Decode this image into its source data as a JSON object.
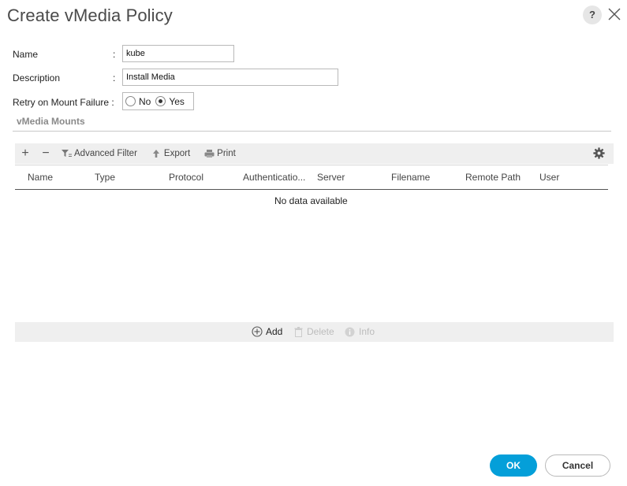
{
  "dialog": {
    "title": "Create vMedia Policy",
    "help_label": "?"
  },
  "form": {
    "name_label": "Name",
    "name_value": "kube",
    "description_label": "Description",
    "description_value": "Install Media",
    "retry_label": "Retry on Mount Failure :",
    "retry_options": [
      "No",
      "Yes"
    ],
    "retry_selected": "Yes",
    "colon": ":"
  },
  "mounts": {
    "section_title": "vMedia Mounts",
    "toolbar": {
      "add_symbol": "+",
      "remove_symbol": "−",
      "advanced_filter_label": "Advanced Filter",
      "export_label": "Export",
      "print_label": "Print"
    },
    "columns": [
      "Name",
      "Type",
      "Protocol",
      "Authenticatio...",
      "Server",
      "Filename",
      "Remote Path",
      "User"
    ],
    "empty_message": "No data available",
    "actions": {
      "add_label": "Add",
      "delete_label": "Delete",
      "info_label": "Info"
    }
  },
  "footer": {
    "ok_label": "OK",
    "cancel_label": "Cancel"
  },
  "colors": {
    "primary": "#049fd9",
    "toolbar_bg": "#efefef",
    "section_title": "#8a8a8a"
  },
  "icons": [
    "help-icon",
    "close-icon",
    "plus-icon",
    "minus-icon",
    "filter-icon",
    "export-icon",
    "print-icon",
    "gear-icon",
    "add-circle-icon",
    "delete-icon",
    "info-icon"
  ]
}
